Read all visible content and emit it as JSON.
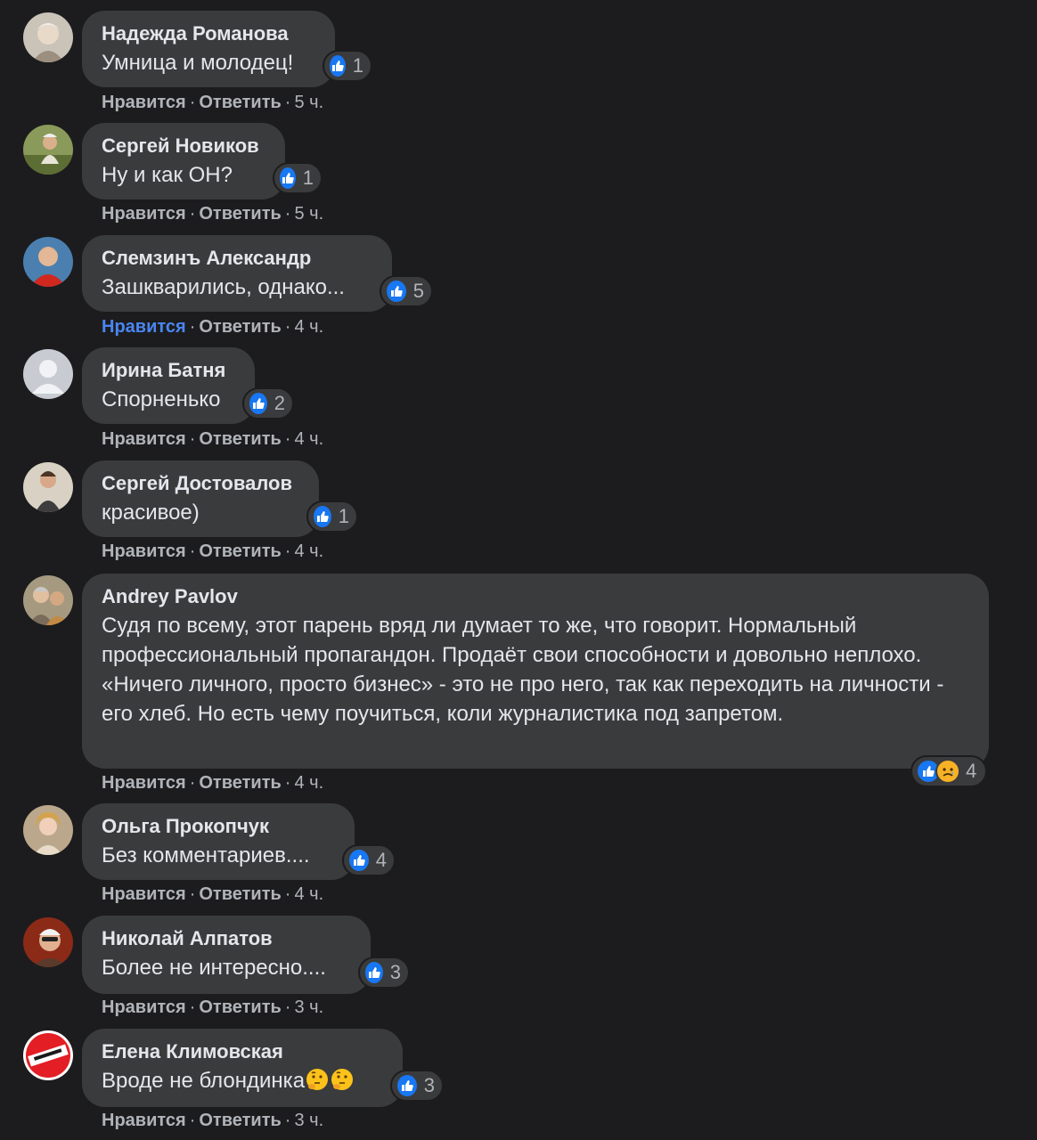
{
  "ui": {
    "like_label": "Нравится",
    "reply_label": "Ответить",
    "separator": "·"
  },
  "colors": {
    "background": "#1c1c1e",
    "bubble": "#3a3b3c",
    "like_blue": "#1877f2",
    "liked_text": "#4a86f0",
    "meta_text": "#b0b3b8"
  },
  "comments": [
    {
      "author": "Надежда Романова",
      "text": "Умница и молодец!",
      "reactions": [
        "like"
      ],
      "count": "1",
      "time": "5 ч.",
      "liked": false,
      "avatar": "photo-avatar"
    },
    {
      "author": "Сергей Новиков",
      "text": "Ну и как ОН?",
      "reactions": [
        "like"
      ],
      "count": "1",
      "time": "5 ч.",
      "liked": false,
      "avatar": "photo-avatar"
    },
    {
      "author": "Слемзинъ Александр",
      "text": "Зашкварились, однако...",
      "reactions": [
        "like"
      ],
      "count": "5",
      "time": "4 ч.",
      "liked": true,
      "avatar": "photo-avatar"
    },
    {
      "author": "Ирина Батня",
      "text": "Спорненько",
      "reactions": [
        "like"
      ],
      "count": "2",
      "time": "4 ч.",
      "liked": false,
      "avatar": "default-avatar"
    },
    {
      "author": "Сергей Достовалов",
      "text": "красивое)",
      "reactions": [
        "like"
      ],
      "count": "1",
      "time": "4 ч.",
      "liked": false,
      "avatar": "photo-avatar"
    },
    {
      "author": "Andrey Pavlov",
      "text": "Судя по всему, этот парень вряд ли думает то же, что говорит. Нормальный профессиональный пропагандон. Продаёт свои способности и довольно неплохо. «Ничего личного, просто бизнес» - это не про него, так как переходить на личности - его хлеб. Но есть чему поучиться, коли журналистика под запретом.",
      "reactions": [
        "like",
        "sad"
      ],
      "count": "4",
      "time": "4 ч.",
      "liked": false,
      "avatar": "photo-avatar"
    },
    {
      "author": "Ольга Прокопчук",
      "text": "Без комментариев....",
      "reactions": [
        "like"
      ],
      "count": "4",
      "time": "4 ч.",
      "liked": false,
      "avatar": "photo-avatar"
    },
    {
      "author": "Николай Алпатов",
      "text": "Более не интересно....",
      "reactions": [
        "like"
      ],
      "count": "3",
      "time": "3 ч.",
      "liked": false,
      "avatar": "photo-avatar"
    },
    {
      "author": "Елена Климовская",
      "text": "Вроде не блондинка",
      "emojis": [
        "thinking-face-emoji",
        "thinking-face-emoji"
      ],
      "reactions": [
        "like"
      ],
      "count": "3",
      "time": "3 ч.",
      "liked": false,
      "avatar": "logo-avatar"
    }
  ]
}
